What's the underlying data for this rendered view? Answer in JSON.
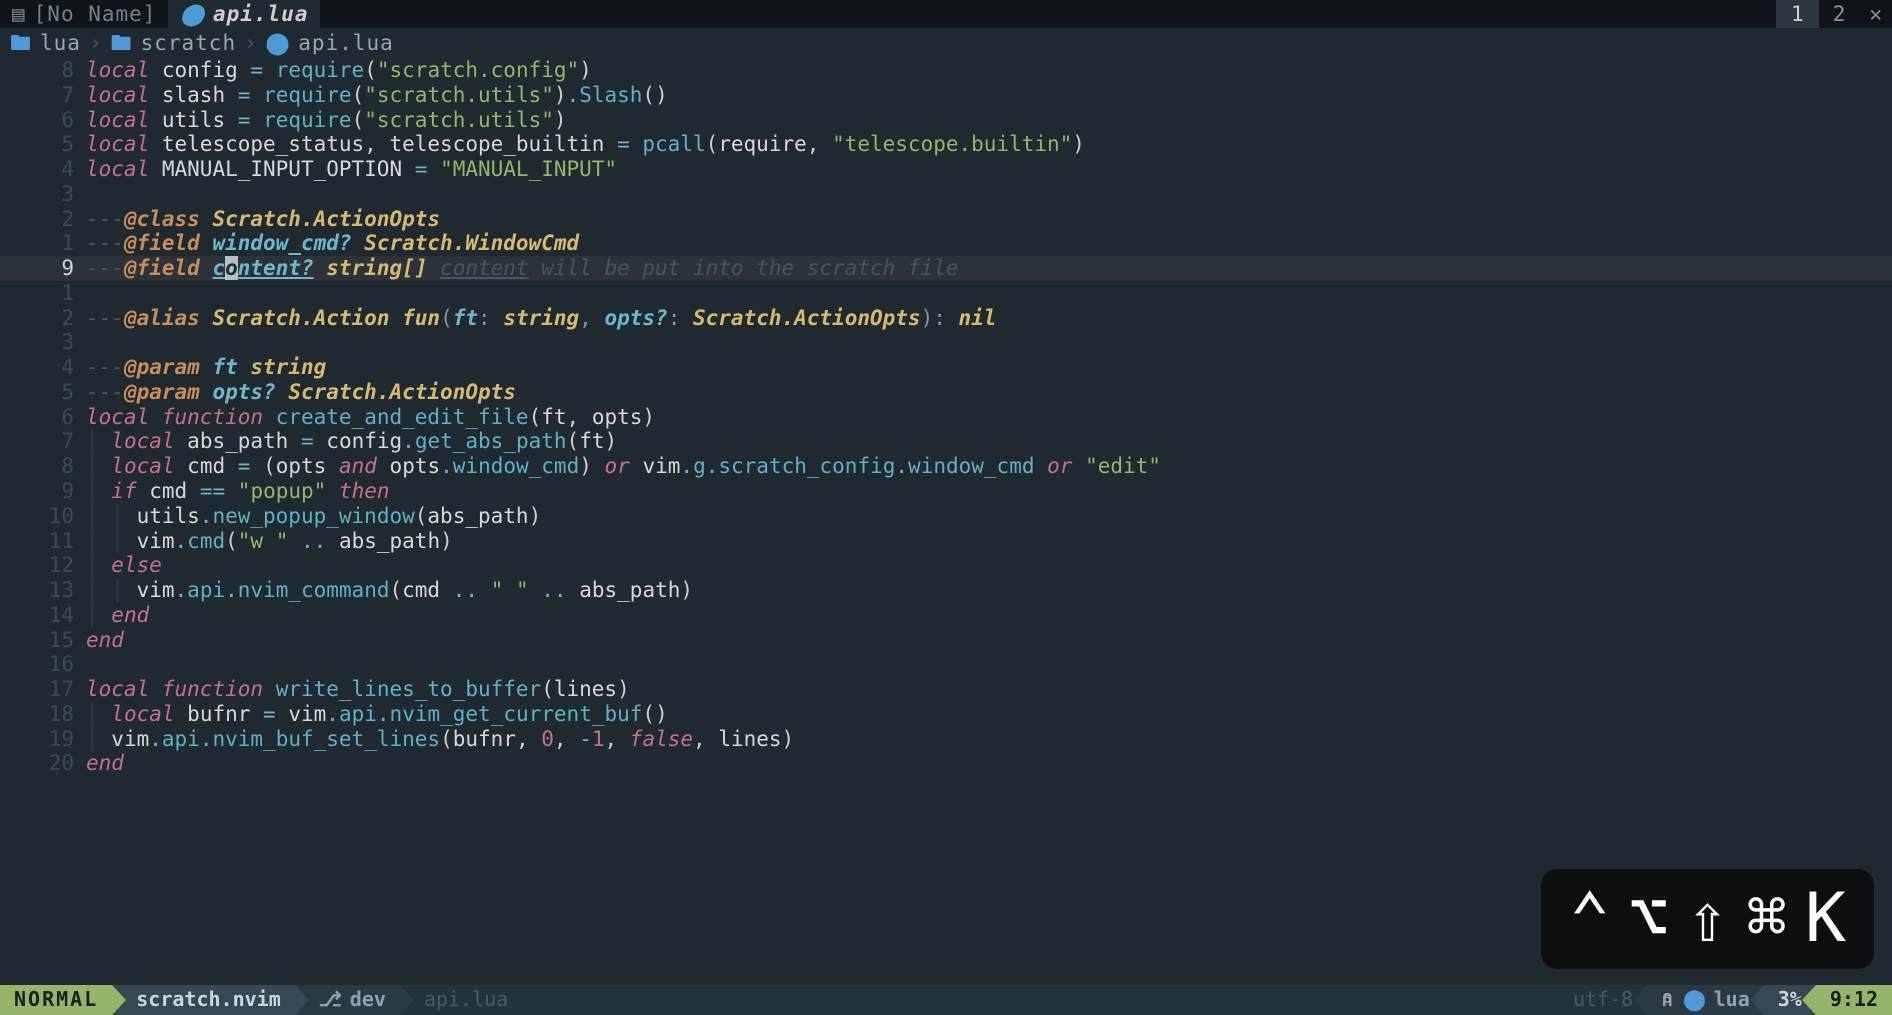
{
  "tabs": {
    "inactive_icon": "▤",
    "inactive_label": "[No Name]",
    "active_icon": "⬤",
    "active_label": "api.lua",
    "num1": "1",
    "num2": "2",
    "close": "✕"
  },
  "breadcrumb": {
    "icon1": "🖿",
    "seg1": "lua",
    "sep": "›",
    "icon2": "🖿",
    "seg2": "scratch",
    "icon3": "⬤",
    "seg3": "api.lua"
  },
  "lines": [
    {
      "num": "8",
      "tokens": [
        [
          "kw",
          "local"
        ],
        [
          "punct",
          " "
        ],
        [
          "ident",
          "config"
        ],
        [
          "punct",
          " "
        ],
        [
          "op",
          "="
        ],
        [
          "punct",
          " "
        ],
        [
          "fn",
          "require"
        ],
        [
          "punct",
          "("
        ],
        [
          "str",
          "\"scratch.config\""
        ],
        [
          "punct",
          ")"
        ]
      ]
    },
    {
      "num": "7",
      "tokens": [
        [
          "kw",
          "local"
        ],
        [
          "punct",
          " "
        ],
        [
          "ident",
          "slash"
        ],
        [
          "punct",
          " "
        ],
        [
          "op",
          "="
        ],
        [
          "punct",
          " "
        ],
        [
          "fn",
          "require"
        ],
        [
          "punct",
          "("
        ],
        [
          "str",
          "\"scratch.utils\""
        ],
        [
          "punct",
          ")"
        ],
        [
          "dot",
          "."
        ],
        [
          "fn",
          "Slash"
        ],
        [
          "punct",
          "()"
        ]
      ]
    },
    {
      "num": "6",
      "tokens": [
        [
          "kw",
          "local"
        ],
        [
          "punct",
          " "
        ],
        [
          "ident",
          "utils"
        ],
        [
          "punct",
          " "
        ],
        [
          "op",
          "="
        ],
        [
          "punct",
          " "
        ],
        [
          "fn",
          "require"
        ],
        [
          "punct",
          "("
        ],
        [
          "str",
          "\"scratch.utils\""
        ],
        [
          "punct",
          ")"
        ]
      ]
    },
    {
      "num": "5",
      "tokens": [
        [
          "kw",
          "local"
        ],
        [
          "punct",
          " "
        ],
        [
          "ident",
          "telescope_status"
        ],
        [
          "punct",
          ", "
        ],
        [
          "ident",
          "telescope_builtin"
        ],
        [
          "punct",
          " "
        ],
        [
          "op",
          "="
        ],
        [
          "punct",
          " "
        ],
        [
          "fn",
          "pcall"
        ],
        [
          "punct",
          "("
        ],
        [
          "ident",
          "require"
        ],
        [
          "punct",
          ", "
        ],
        [
          "str",
          "\"telescope.builtin\""
        ],
        [
          "punct",
          ")"
        ]
      ]
    },
    {
      "num": "4",
      "tokens": [
        [
          "kw",
          "local"
        ],
        [
          "punct",
          " "
        ],
        [
          "ident",
          "MANUAL_INPUT_OPTION"
        ],
        [
          "punct",
          " "
        ],
        [
          "op",
          "="
        ],
        [
          "punct",
          " "
        ],
        [
          "str",
          "\"MANUAL_INPUT\""
        ]
      ]
    },
    {
      "num": "3",
      "tokens": []
    },
    {
      "num": "2",
      "tokens": [
        [
          "cmt",
          "---"
        ],
        [
          "ann",
          "@class"
        ],
        [
          "cmt",
          " "
        ],
        [
          "type",
          "Scratch.ActionOpts"
        ]
      ]
    },
    {
      "num": "1",
      "tokens": [
        [
          "cmt",
          "---"
        ],
        [
          "ann",
          "@field"
        ],
        [
          "cmt",
          " "
        ],
        [
          "field",
          "window_cmd?"
        ],
        [
          "cmt",
          " "
        ],
        [
          "type",
          "Scratch.WindowCmd"
        ]
      ]
    },
    {
      "num": "9",
      "current": true,
      "tokens": [
        [
          "cmt",
          "---"
        ],
        [
          "ann",
          "@field"
        ],
        [
          "cmt",
          " "
        ],
        [
          "field-u",
          "c"
        ],
        [
          "cursor",
          "o"
        ],
        [
          "field-u",
          "ntent?"
        ],
        [
          "cmt",
          " "
        ],
        [
          "type2",
          "string[]"
        ],
        [
          "cmt",
          " "
        ],
        [
          "cmt-u",
          "content"
        ],
        [
          "cmt-txt",
          " will be put into the scratch file"
        ]
      ]
    },
    {
      "num": "1",
      "tokens": []
    },
    {
      "num": "2",
      "tokens": [
        [
          "cmt",
          "---"
        ],
        [
          "ann",
          "@alias"
        ],
        [
          "cmt",
          " "
        ],
        [
          "type",
          "Scratch.Action"
        ],
        [
          "cmt",
          " "
        ],
        [
          "type2",
          "fun"
        ],
        [
          "punct-dim",
          "("
        ],
        [
          "field",
          "ft"
        ],
        [
          "punct-dim",
          ": "
        ],
        [
          "type2",
          "string"
        ],
        [
          "punct-dim",
          ", "
        ],
        [
          "field",
          "opts?"
        ],
        [
          "punct-dim",
          ": "
        ],
        [
          "type",
          "Scratch.ActionOpts"
        ],
        [
          "punct-dim",
          "): "
        ],
        [
          "type2",
          "nil"
        ]
      ]
    },
    {
      "num": "3",
      "tokens": []
    },
    {
      "num": "4",
      "tokens": [
        [
          "cmt",
          "---"
        ],
        [
          "ann",
          "@param"
        ],
        [
          "cmt",
          " "
        ],
        [
          "field",
          "ft"
        ],
        [
          "cmt",
          " "
        ],
        [
          "type2",
          "string"
        ]
      ]
    },
    {
      "num": "5",
      "tokens": [
        [
          "cmt",
          "---"
        ],
        [
          "ann",
          "@param"
        ],
        [
          "cmt",
          " "
        ],
        [
          "field",
          "opts?"
        ],
        [
          "cmt",
          " "
        ],
        [
          "type",
          "Scratch.ActionOpts"
        ]
      ]
    },
    {
      "num": "6",
      "tokens": [
        [
          "kw",
          "local"
        ],
        [
          "punct",
          " "
        ],
        [
          "kw",
          "function"
        ],
        [
          "punct",
          " "
        ],
        [
          "fn",
          "create_and_edit_file"
        ],
        [
          "punct",
          "("
        ],
        [
          "ident",
          "ft"
        ],
        [
          "punct",
          ", "
        ],
        [
          "ident",
          "opts"
        ],
        [
          "punct",
          ")"
        ]
      ]
    },
    {
      "num": "7",
      "tokens": [
        [
          "indent",
          "│ "
        ],
        [
          "kw",
          "local"
        ],
        [
          "punct",
          " "
        ],
        [
          "ident",
          "abs_path"
        ],
        [
          "punct",
          " "
        ],
        [
          "op",
          "="
        ],
        [
          "punct",
          " "
        ],
        [
          "ident",
          "config"
        ],
        [
          "dot",
          "."
        ],
        [
          "fn",
          "get_abs_path"
        ],
        [
          "punct",
          "("
        ],
        [
          "ident",
          "ft"
        ],
        [
          "punct",
          ")"
        ]
      ]
    },
    {
      "num": "8",
      "tokens": [
        [
          "indent",
          "│ "
        ],
        [
          "kw",
          "local"
        ],
        [
          "punct",
          " "
        ],
        [
          "ident",
          "cmd"
        ],
        [
          "punct",
          " "
        ],
        [
          "op",
          "="
        ],
        [
          "punct",
          " ("
        ],
        [
          "ident",
          "opts"
        ],
        [
          "punct",
          " "
        ],
        [
          "kw",
          "and"
        ],
        [
          "punct",
          " "
        ],
        [
          "ident",
          "opts"
        ],
        [
          "dot",
          "."
        ],
        [
          "prop",
          "window_cmd"
        ],
        [
          "punct",
          ") "
        ],
        [
          "kw",
          "or"
        ],
        [
          "punct",
          " "
        ],
        [
          "ident",
          "vim"
        ],
        [
          "dot",
          "."
        ],
        [
          "prop",
          "g"
        ],
        [
          "dot",
          "."
        ],
        [
          "prop",
          "scratch_config"
        ],
        [
          "dot",
          "."
        ],
        [
          "prop",
          "window_cmd"
        ],
        [
          "punct",
          " "
        ],
        [
          "kw",
          "or"
        ],
        [
          "punct",
          " "
        ],
        [
          "str",
          "\"edit\""
        ]
      ]
    },
    {
      "num": "9",
      "tokens": [
        [
          "indent",
          "│ "
        ],
        [
          "kw",
          "if"
        ],
        [
          "punct",
          " "
        ],
        [
          "ident",
          "cmd"
        ],
        [
          "punct",
          " "
        ],
        [
          "op",
          "=="
        ],
        [
          "punct",
          " "
        ],
        [
          "str",
          "\"popup\""
        ],
        [
          "punct",
          " "
        ],
        [
          "kw",
          "then"
        ]
      ]
    },
    {
      "num": "10",
      "tokens": [
        [
          "indent",
          "│ │ "
        ],
        [
          "ident",
          "utils"
        ],
        [
          "dot",
          "."
        ],
        [
          "fn",
          "new_popup_window"
        ],
        [
          "punct",
          "("
        ],
        [
          "ident",
          "abs_path"
        ],
        [
          "punct",
          ")"
        ]
      ]
    },
    {
      "num": "11",
      "tokens": [
        [
          "indent",
          "│ │ "
        ],
        [
          "ident",
          "vim"
        ],
        [
          "dot",
          "."
        ],
        [
          "fn",
          "cmd"
        ],
        [
          "punct",
          "("
        ],
        [
          "str",
          "\"w \""
        ],
        [
          "punct",
          " "
        ],
        [
          "op",
          ".."
        ],
        [
          "punct",
          " "
        ],
        [
          "ident",
          "abs_path"
        ],
        [
          "punct",
          ")"
        ]
      ]
    },
    {
      "num": "12",
      "tokens": [
        [
          "indent",
          "│ "
        ],
        [
          "kw",
          "else"
        ]
      ]
    },
    {
      "num": "13",
      "tokens": [
        [
          "indent",
          "│ │ "
        ],
        [
          "ident",
          "vim"
        ],
        [
          "dot",
          "."
        ],
        [
          "prop",
          "api"
        ],
        [
          "dot",
          "."
        ],
        [
          "fn",
          "nvim_command"
        ],
        [
          "punct",
          "("
        ],
        [
          "ident",
          "cmd"
        ],
        [
          "punct",
          " "
        ],
        [
          "op",
          ".."
        ],
        [
          "punct",
          " "
        ],
        [
          "str",
          "\" \""
        ],
        [
          "punct",
          " "
        ],
        [
          "op",
          ".."
        ],
        [
          "punct",
          " "
        ],
        [
          "ident",
          "abs_path"
        ],
        [
          "punct",
          ")"
        ]
      ]
    },
    {
      "num": "14",
      "tokens": [
        [
          "indent",
          "│ "
        ],
        [
          "kw",
          "end"
        ]
      ]
    },
    {
      "num": "15",
      "tokens": [
        [
          "kw",
          "end"
        ]
      ]
    },
    {
      "num": "16",
      "tokens": []
    },
    {
      "num": "17",
      "tokens": [
        [
          "kw",
          "local"
        ],
        [
          "punct",
          " "
        ],
        [
          "kw",
          "function"
        ],
        [
          "punct",
          " "
        ],
        [
          "fn",
          "write_lines_to_buffer"
        ],
        [
          "punct",
          "("
        ],
        [
          "ident",
          "lines"
        ],
        [
          "punct",
          ")"
        ]
      ]
    },
    {
      "num": "18",
      "tokens": [
        [
          "indent",
          "│ "
        ],
        [
          "kw",
          "local"
        ],
        [
          "punct",
          " "
        ],
        [
          "ident",
          "bufnr"
        ],
        [
          "punct",
          " "
        ],
        [
          "op",
          "="
        ],
        [
          "punct",
          " "
        ],
        [
          "ident",
          "vim"
        ],
        [
          "dot",
          "."
        ],
        [
          "prop",
          "api"
        ],
        [
          "dot",
          "."
        ],
        [
          "fn",
          "nvim_get_current_buf"
        ],
        [
          "punct",
          "()"
        ]
      ]
    },
    {
      "num": "19",
      "tokens": [
        [
          "indent",
          "│ "
        ],
        [
          "ident",
          "vim"
        ],
        [
          "dot",
          "."
        ],
        [
          "prop",
          "api"
        ],
        [
          "dot",
          "."
        ],
        [
          "fn",
          "nvim_buf_set_lines"
        ],
        [
          "punct",
          "("
        ],
        [
          "ident",
          "bufnr"
        ],
        [
          "punct",
          ", "
        ],
        [
          "num-lit",
          "0"
        ],
        [
          "punct",
          ", "
        ],
        [
          "op",
          "-"
        ],
        [
          "num-lit",
          "1"
        ],
        [
          "punct",
          ", "
        ],
        [
          "bool",
          "false"
        ],
        [
          "punct",
          ", "
        ],
        [
          "ident",
          "lines"
        ],
        [
          "punct",
          ")"
        ]
      ]
    },
    {
      "num": "20",
      "tokens": [
        [
          "kw",
          "end"
        ]
      ]
    }
  ],
  "statusline": {
    "mode": "NORMAL",
    "project": "scratch.nvim",
    "branch_icon": "⎇",
    "branch": "dev",
    "file": "api.lua",
    "encoding": "utf-8",
    "os_icon": "⍝",
    "ft_icon": "⬤",
    "ft": "lua",
    "percent": "3%",
    "pos": "9:12"
  },
  "key_overlay": {
    "ctrl": "⌃",
    "option": "⌥",
    "shift": "⇧",
    "cmd": "⌘",
    "key": "K"
  }
}
